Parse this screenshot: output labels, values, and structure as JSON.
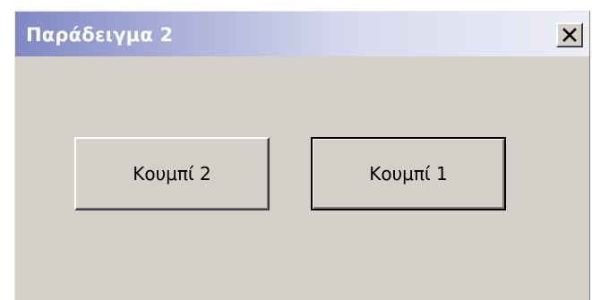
{
  "window": {
    "title": "Παράδειγμα 2",
    "close_icon": "close-icon"
  },
  "buttons": {
    "button_2_label": "Κουμπί 2",
    "button_1_label": "Κουμπί 1"
  },
  "colors": {
    "titlebar_start": "#7f88c4",
    "titlebar_end": "#ecedf6",
    "face": "#d4d0c8"
  }
}
